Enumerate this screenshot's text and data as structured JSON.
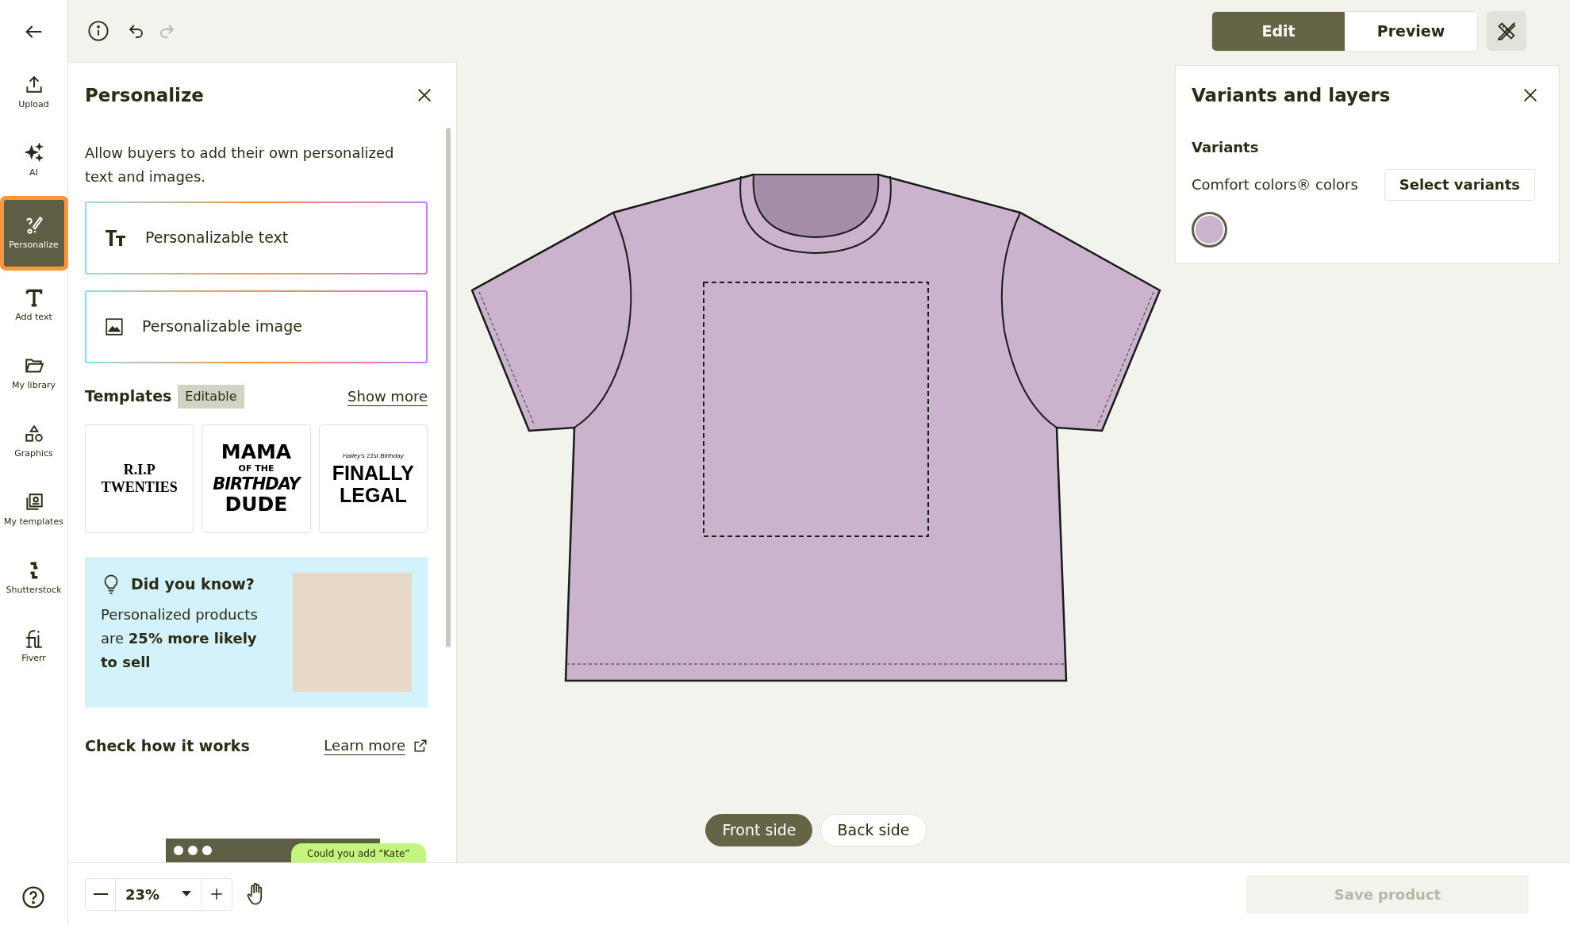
{
  "rail": {
    "items": [
      {
        "label": "Upload",
        "selected": false
      },
      {
        "label": "AI",
        "selected": false
      },
      {
        "label": "Personalize",
        "selected": true
      },
      {
        "label": "Add text",
        "selected": false
      },
      {
        "label": "My library",
        "selected": false
      },
      {
        "label": "Graphics",
        "selected": false
      },
      {
        "label": "My templates",
        "selected": false
      },
      {
        "label": "Shutterstock",
        "selected": false
      },
      {
        "label": "Fiverr",
        "selected": false
      }
    ]
  },
  "history": [
    {
      "kind": "undo",
      "disabled": false
    },
    {
      "kind": "redo",
      "disabled": true
    }
  ],
  "mode_toggle": [
    {
      "label": "Edit",
      "selected": true
    },
    {
      "label": "Preview",
      "selected": false
    }
  ],
  "personalize_panel": {
    "title": "Personalize",
    "description": "Allow buyers to add their own personalized text and images.",
    "options": [
      {
        "label": "Personalizable text",
        "kind": "text"
      },
      {
        "label": "Personalizable image",
        "kind": "image"
      }
    ],
    "templates": {
      "title": "Templates",
      "badge": "Editable",
      "link": "Show more",
      "cards": [
        {
          "lines": [
            {
              "text": "R.I.P",
              "kind": "medium"
            },
            {
              "text": "TWENTIES",
              "kind": "medium"
            }
          ]
        },
        {
          "lines": [
            {
              "text": "MAMA",
              "kind": "large"
            },
            {
              "text": "OF THE",
              "kind": "small"
            },
            {
              "text": "BIRTHDAY",
              "kind": "italic"
            },
            {
              "text": "DUDE",
              "kind": "large"
            }
          ]
        },
        {
          "lines": [
            {
              "text": "Hailey's 21st Birthday",
              "kind": "script"
            },
            {
              "text": "FINALLY",
              "kind": "large"
            },
            {
              "text": "LEGAL",
              "kind": "large"
            }
          ]
        }
      ]
    },
    "tip": {
      "title": "Did you know?",
      "body": "Personalized products are **25% more likely to sell**"
    },
    "how_it_works": {
      "title": "Check how it works",
      "link": "Learn more",
      "preview_message": "Could you add “Kate”"
    }
  },
  "sides": [
    {
      "label": "Front side",
      "selected": true
    },
    {
      "label": "Back side",
      "selected": false
    }
  ],
  "variants_panel": {
    "title": "Variants and layers",
    "section": "Variants",
    "label": "Comfort colors® colors",
    "button": "Select variants",
    "swatches": [
      {
        "color": "#cbb2cd",
        "selected": true
      }
    ]
  },
  "zoom": {
    "value": "23%"
  },
  "save_button": {
    "label": "Save product",
    "disabled": true
  }
}
